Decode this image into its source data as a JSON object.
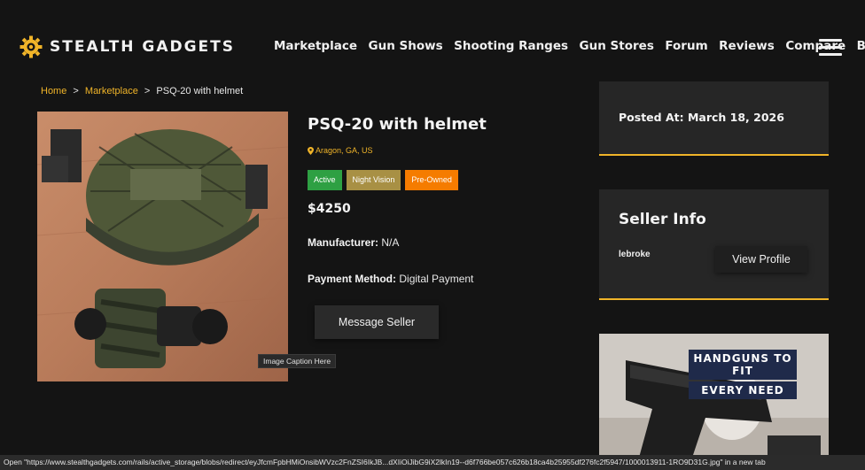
{
  "brand": {
    "name": "STEALTH GADGETS",
    "logo_icon": "gear-logo-icon",
    "accent": "#f0b429"
  },
  "nav": {
    "items": [
      "Marketplace",
      "Gun Shows",
      "Shooting Ranges",
      "Gun Stores",
      "Forum",
      "Reviews",
      "Compare",
      "Blog"
    ],
    "menu_icon": "hamburger-menu-icon"
  },
  "breadcrumb": {
    "home": "Home",
    "separator": ">",
    "section": "Marketplace",
    "current": "PSQ-20 with helmet"
  },
  "product": {
    "title": "PSQ-20 with helmet",
    "location": "Aragon, GA, US",
    "badges": [
      {
        "label": "Active",
        "color": "#2ea043"
      },
      {
        "label": "Night Vision",
        "color": "#a89044"
      },
      {
        "label": "Pre-Owned",
        "color": "#f57c00"
      }
    ],
    "price": "$4250",
    "manufacturer_label": "Manufacturer:",
    "manufacturer_value": "N/A",
    "payment_label": "Payment Method:",
    "payment_value": "Digital Payment",
    "message_button": "Message Seller",
    "image_caption": "Image Caption Here"
  },
  "posted": {
    "text": "Posted At: March 18, 2026"
  },
  "seller": {
    "title": "Seller Info",
    "name": "lebroke",
    "profile_button": "View Profile"
  },
  "ad": {
    "line1": "HANDGUNS TO FIT",
    "line2": "EVERY NEED"
  },
  "statusbar": {
    "text": "Open \"https://www.stealthgadgets.com/rails/active_storage/blobs/redirect/eyJfcmFpbHMiOnsibWVzc2FnZSI6IkJB...dXIiOiJibG9iX2lkIn19--d6f766be057c626b18ca4b25955df276fc2f5947/1000013911-1RO9D31G.jpg\" in a new tab"
  }
}
